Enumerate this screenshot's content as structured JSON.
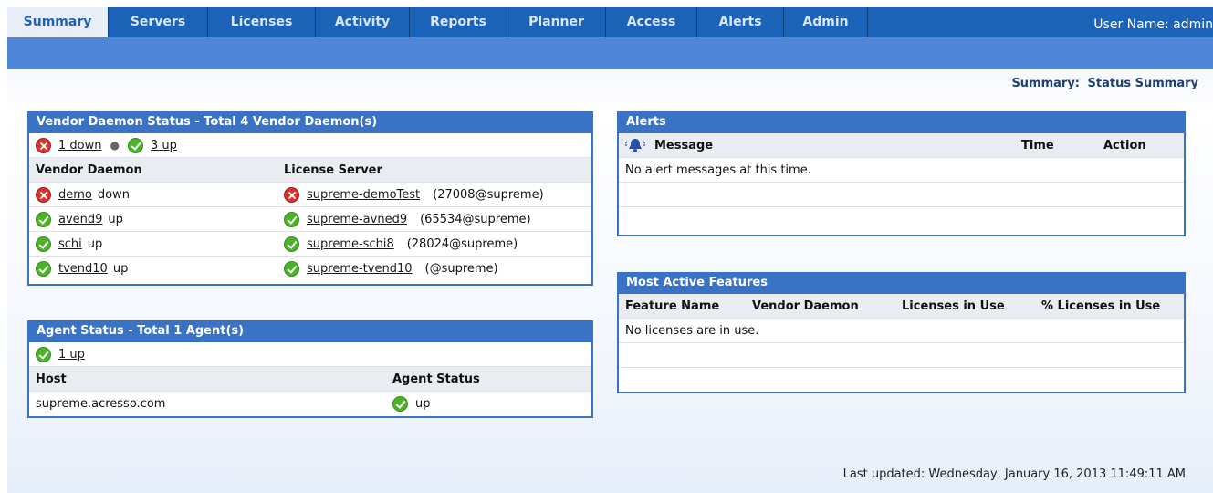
{
  "nav": {
    "tabs": [
      "Summary",
      "Servers",
      "Licenses",
      "Activity",
      "Reports",
      "Planner",
      "Access",
      "Alerts",
      "Admin"
    ],
    "active": "Summary",
    "user": "User Name: admin"
  },
  "breadcrumb": {
    "section": "Summary:",
    "page": "Status Summary"
  },
  "vendor": {
    "title": "Vendor Daemon Status - Total 4 Vendor Daemon(s)",
    "down_link": "1 down",
    "up_link": "3 up",
    "col_daemon": "Vendor Daemon",
    "col_server": "License Server",
    "rows": [
      {
        "status": "down",
        "daemon": "demo",
        "state": "down",
        "server": "supreme-demoTest",
        "port": "(27008@supreme)"
      },
      {
        "status": "up",
        "daemon": "avend9",
        "state": "up",
        "server": "supreme-avned9",
        "port": "(65534@supreme)"
      },
      {
        "status": "up",
        "daemon": "schi",
        "state": "up",
        "server": "supreme-schi8",
        "port": "(28024@supreme)"
      },
      {
        "status": "up",
        "daemon": "tvend10",
        "state": "up",
        "server": "supreme-tvend10",
        "port": "(@supreme)"
      }
    ]
  },
  "agent": {
    "title": "Agent Status - Total 1 Agent(s)",
    "up_link": "1 up",
    "col_host": "Host",
    "col_status": "Agent Status",
    "host": "supreme.acresso.com",
    "status": "up"
  },
  "alerts": {
    "title": "Alerts",
    "col_message": "Message",
    "col_time": "Time",
    "col_action": "Action",
    "empty": "No alert messages at this time."
  },
  "features": {
    "title": "Most Active Features",
    "col_name": "Feature Name",
    "col_daemon": "Vendor Daemon",
    "col_inuse": "Licenses in Use",
    "col_pct": "% Licenses in Use",
    "empty": "No licenses are in use."
  },
  "footer": {
    "last_updated": "Last updated: Wednesday, January 16, 2013 11:49:11 AM"
  },
  "colors": {
    "nav": "#1a63b8",
    "subbar": "#4f86d8",
    "panel_header": "#3a72c6",
    "ok": "#4cb22a",
    "error": "#d8322a"
  }
}
